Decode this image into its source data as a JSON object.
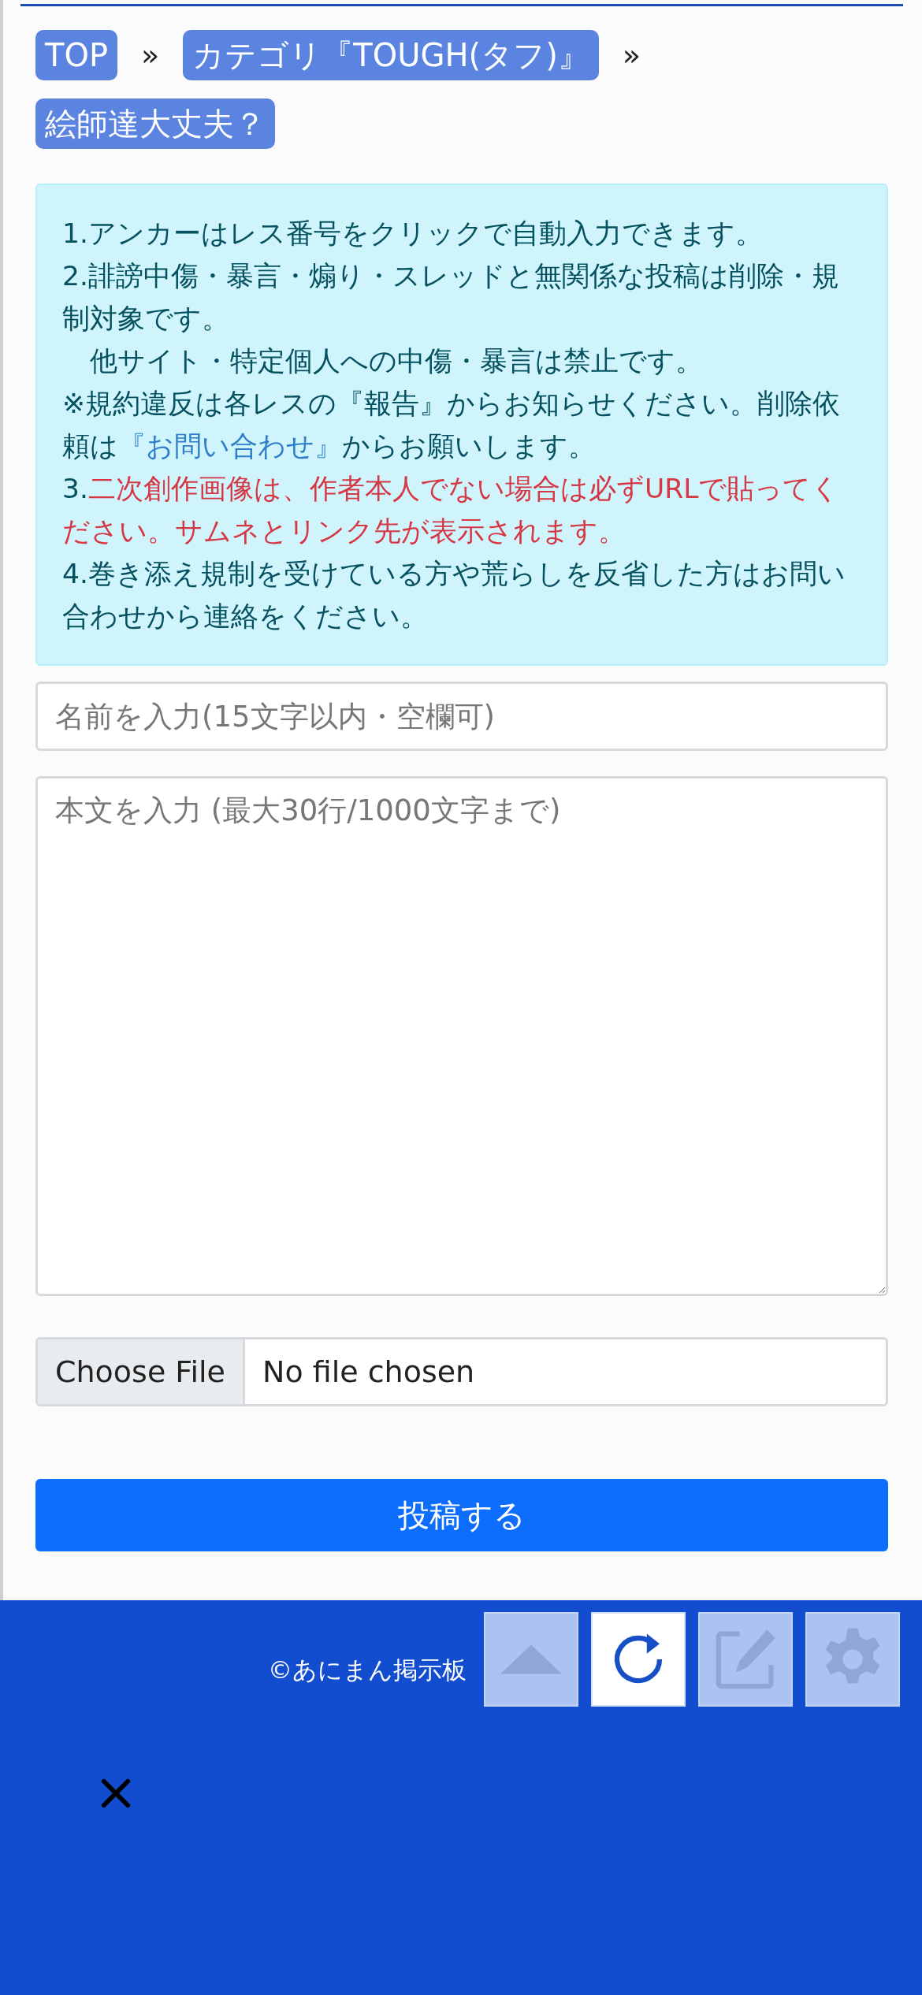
{
  "breadcrumbs": [
    {
      "label": "TOP"
    },
    {
      "label": "カテゴリ『TOUGH(タフ)』"
    },
    {
      "label": "絵師達大丈夫？"
    }
  ],
  "separator": "»",
  "notice": [
    {
      "parts": [
        {
          "kind": "text",
          "text": "1.アンカーはレス番号をクリックで自動入力できます。"
        }
      ]
    },
    {
      "parts": [
        {
          "kind": "text",
          "text": "2.誹謗中傷・暴言・煽り・スレッドと無関係な投稿は削除・規制対象です。"
        }
      ]
    },
    {
      "parts": [
        {
          "kind": "text",
          "text": "　他サイト・特定個人への中傷・暴言は禁止です。"
        }
      ]
    },
    {
      "parts": [
        {
          "kind": "text",
          "text": "※規約違反は各レスの『報告』からお知らせください。削除依頼は"
        },
        {
          "kind": "link",
          "text": "『お問い合わせ』"
        },
        {
          "kind": "text",
          "text": "からお願いします。"
        }
      ]
    },
    {
      "parts": [
        {
          "kind": "text",
          "text": "3."
        },
        {
          "kind": "warn",
          "text": "二次創作画像は、作者本人でない場合は必ずURLで貼ってください。サムネとリンク先が表示されます。"
        }
      ]
    },
    {
      "parts": [
        {
          "kind": "text",
          "text": "4.巻き添え規制を受けている方や荒らしを反省した方はお問い合わせから連絡をください。"
        }
      ]
    }
  ],
  "name_field": {
    "placeholder": "名前を入力(15文字以内・空欄可)"
  },
  "body_field": {
    "placeholder": "本文を入力 (最大30行/1000文字まで)"
  },
  "file_input": {
    "button": "Choose File",
    "status": "No file chosen"
  },
  "submit": "投稿する",
  "footer": {
    "copyright": "©あにまん掲示板"
  },
  "float_buttons": [
    {
      "kind": "up",
      "active": false
    },
    {
      "kind": "reload",
      "active": true
    },
    {
      "kind": "edit",
      "active": false
    },
    {
      "kind": "settings",
      "active": false
    }
  ]
}
